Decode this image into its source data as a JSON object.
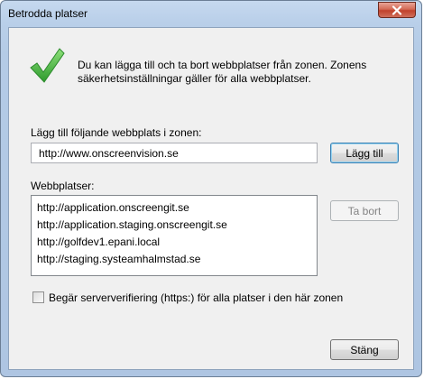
{
  "window": {
    "title": "Betrodda platser",
    "close_icon": "close-x-icon"
  },
  "intro": {
    "icon": "green-checkmark-icon",
    "text": "Du kan lägga till och ta bort webbplatser från zonen. Zonens säkerhetsinställningar gäller för alla webbplatser."
  },
  "add_site": {
    "label": "Lägg till följande webbplats i zonen:",
    "value": "http://www.onscreenvision.se",
    "button_label": "Lägg till"
  },
  "sites": {
    "label": "Webbplatser:",
    "items": [
      "http://application.onscreengit.se",
      "http://application.staging.onscreengit.se",
      "http://golfdev1.epani.local",
      "http://staging.systeamhalmstad.se"
    ],
    "remove_label": "Ta bort"
  },
  "https_option": {
    "label": "Begär serververifiering (https:) för alla platser i den här zonen",
    "checked": false
  },
  "footer": {
    "close_label": "Stäng"
  },
  "colors": {
    "title_bar": "#b9cfe9",
    "close_button": "#c1412b",
    "check_green": "#3aa53a",
    "dialog_bg": "#f0f0f0"
  }
}
